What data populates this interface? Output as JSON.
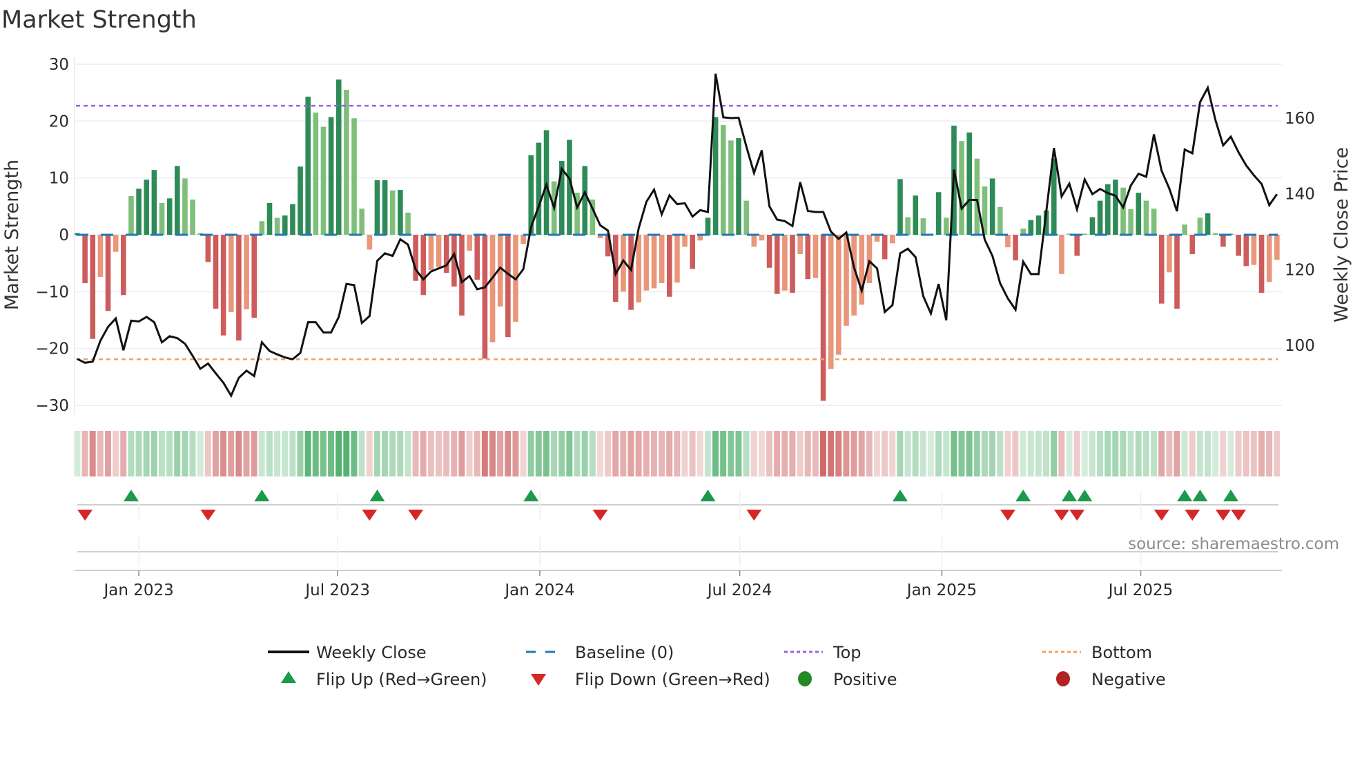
{
  "chart_data": {
    "type": "bar",
    "title": "Market Strength",
    "ylabel": "Market Strength",
    "y2label": "Weekly Close Price",
    "ylim": [
      -30,
      30
    ],
    "y2lim": [
      80,
      175
    ],
    "yticks": [
      "30",
      "20",
      "10",
      "0",
      "−10",
      "−20",
      "−30"
    ],
    "ytick_values": [
      30,
      20,
      10,
      0,
      -10,
      -20,
      -30
    ],
    "y2ticks": [
      "160",
      "140",
      "120",
      "100"
    ],
    "y2tick_values": [
      160,
      140,
      120,
      100
    ],
    "xticks": [
      {
        "label": "Jan 2023",
        "date": "2023-01-01"
      },
      {
        "label": "Jul 2023",
        "date": "2023-07-01"
      },
      {
        "label": "Jan 2024",
        "date": "2024-01-01"
      },
      {
        "label": "Jul 2024",
        "date": "2024-07-01"
      },
      {
        "label": "Jan 2025",
        "date": "2025-01-01"
      },
      {
        "label": "Jul 2025",
        "date": "2025-07-01"
      }
    ],
    "start_date": "2022-11-06",
    "frequency": "weekly",
    "grid": true,
    "top_level": 22.7,
    "bottom_level": -21.9,
    "baseline": 0,
    "strength": [
      0.3,
      -8.5,
      -18.3,
      -7.4,
      -13.4,
      -3.0,
      -10.6,
      6.8,
      8.1,
      9.7,
      11.4,
      5.6,
      6.4,
      12.1,
      9.9,
      6.2,
      0.3,
      -4.8,
      -13.0,
      -17.7,
      -13.6,
      -18.6,
      -13.1,
      -14.6,
      2.4,
      5.6,
      3.0,
      3.4,
      5.4,
      12.0,
      24.3,
      21.5,
      19.0,
      20.7,
      27.3,
      25.5,
      20.5,
      4.6,
      -2.6,
      9.6,
      9.6,
      7.8,
      7.9,
      3.9,
      -8.1,
      -10.6,
      -6.2,
      -5.7,
      -6.7,
      -9.1,
      -14.2,
      -2.8,
      -7.9,
      -21.8,
      -18.9,
      -12.6,
      -18.0,
      -15.3,
      -1.6,
      14.0,
      16.2,
      18.4,
      9.4,
      13.0,
      16.7,
      7.4,
      12.1,
      6.2,
      -0.6,
      -3.8,
      -11.8,
      -10.0,
      -13.2,
      -11.9,
      -9.8,
      -9.4,
      -8.5,
      -10.9,
      -8.4,
      -2.1,
      -6.0,
      -1.0,
      3.0,
      20.7,
      19.3,
      16.6,
      17.0,
      6.0,
      -2.1,
      -1.0,
      -5.8,
      -10.4,
      -9.8,
      -10.2,
      -3.4,
      -7.8,
      -7.6,
      -29.2,
      -23.6,
      -21.1,
      -16.0,
      -14.2,
      -12.3,
      -8.5,
      -1.2,
      -4.3,
      -1.5,
      9.8,
      3.1,
      6.9,
      2.9,
      0.2,
      7.5,
      3.0,
      19.2,
      16.5,
      18.0,
      13.4,
      8.5,
      9.9,
      4.9,
      -2.2,
      -4.5,
      1.1,
      2.6,
      3.4,
      4.3,
      13.4,
      -6.9,
      0.2,
      -3.7,
      0.2,
      3.1,
      6.0,
      8.9,
      9.7,
      8.3,
      4.5,
      7.4,
      6.0,
      4.6,
      -12.1,
      -6.6,
      -13.0,
      1.8,
      -3.4,
      3.0,
      3.8,
      0.3,
      -2.1,
      0.2,
      -3.7,
      -5.5,
      -5.3,
      -10.2,
      -8.3,
      -4.4
    ],
    "weekly_close": [
      96.4,
      95.4,
      95.7,
      101.2,
      104.9,
      107.1,
      98.7,
      106.5,
      106.3,
      107.5,
      106.1,
      100.8,
      102.4,
      101.9,
      100.4,
      97.2,
      93.8,
      95.2,
      92.6,
      90.1,
      86.7,
      91.4,
      93.3,
      91.9,
      100.8,
      98.5,
      97.6,
      96.8,
      96.3,
      98.0,
      106.1,
      106.1,
      103.4,
      103.4,
      107.5,
      116.2,
      115.9,
      105.9,
      107.7,
      122.3,
      124.3,
      123.6,
      128.0,
      126.6,
      120.0,
      117.4,
      119.5,
      120.3,
      121.1,
      124.1,
      116.7,
      118.3,
      114.8,
      115.3,
      117.9,
      120.5,
      118.9,
      117.4,
      120.1,
      131.2,
      136.7,
      142.4,
      136.3,
      146.6,
      144.0,
      136.4,
      140.4,
      136.1,
      131.7,
      130.3,
      118.8,
      122.4,
      119.9,
      130.9,
      137.9,
      141.1,
      134.6,
      139.6,
      137.3,
      137.5,
      134.0,
      135.7,
      135.2,
      171.7,
      160.2,
      160.0,
      160.1,
      152.5,
      145.5,
      151.5,
      136.7,
      133.2,
      132.8,
      131.5,
      143.1,
      135.5,
      135.2,
      135.2,
      130.0,
      128.1,
      129.8,
      120.6,
      114.4,
      122.2,
      120.3,
      108.8,
      110.6,
      124.3,
      125.5,
      123.3,
      113.0,
      108.4,
      116.2,
      106.6,
      146.4,
      136.1,
      138.4,
      138.4,
      127.9,
      123.6,
      116.4,
      112.4,
      109.4,
      122.1,
      118.8,
      118.8,
      135.2,
      152.1,
      139.3,
      142.7,
      135.9,
      143.8,
      139.9,
      141.3,
      140.2,
      139.5,
      136.4,
      142.2,
      145.3,
      144.5,
      155.7,
      146.1,
      141.4,
      135.4,
      151.7,
      150.7,
      164.2,
      168.0,
      159.5,
      152.8,
      155.1,
      151.0,
      147.5,
      144.9,
      142.6,
      137.0,
      139.9
    ],
    "flip_up_weeks": [
      7,
      24,
      39,
      59,
      82,
      107,
      123,
      129,
      131,
      144,
      146,
      150
    ],
    "flip_down_weeks": [
      1,
      17,
      38,
      44,
      68,
      88,
      121,
      128,
      130,
      141,
      145,
      149,
      151
    ],
    "legend": {
      "placement": "bottom",
      "entries": [
        {
          "label": "Weekly Close",
          "symbol": "line"
        },
        {
          "label": "Baseline (0)",
          "symbol": "dashed"
        },
        {
          "label": "Top",
          "symbol": "dotted-purple"
        },
        {
          "label": "Bottom",
          "symbol": "dotted-orange"
        },
        {
          "label": "Flip Up (Red→Green)",
          "symbol": "triangle-up"
        },
        {
          "label": "Flip Down (Green→Red)",
          "symbol": "triangle-down"
        },
        {
          "label": "Positive",
          "symbol": "circle-green"
        },
        {
          "label": "Negative",
          "symbol": "circle-red"
        }
      ]
    },
    "annotation": "source: sharemaestro.com"
  },
  "colors": {
    "pos_strong": "#2e8b57",
    "pos_weak": "#7fbf7b",
    "neg_strong": "#cd5c5c",
    "neg_weak": "#e9967a",
    "line": "#111111",
    "top": "#9b5fe0",
    "bottom": "#f0a060",
    "baseline": "#1f77b4",
    "flip_up": "#1a9a4a",
    "flip_down": "#d62728",
    "positive_dot": "#228b22",
    "negative_dot": "#b22222"
  }
}
